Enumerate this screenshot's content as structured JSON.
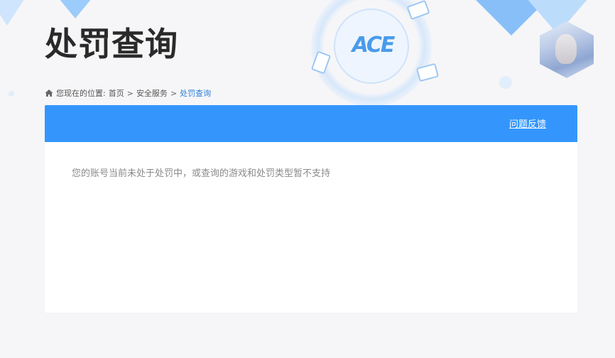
{
  "page": {
    "title": "处罚查询"
  },
  "header_art": {
    "logo_text": "ACE"
  },
  "breadcrumb": {
    "prefix": "您现在的位置:",
    "items": [
      "首页",
      "安全服务",
      "处罚查询"
    ],
    "separator": ">"
  },
  "panel": {
    "feedback_label": "问题反馈",
    "notice": "您的账号当前未处于处罚中，或查询的游戏和处罚类型暂不支持"
  },
  "colors": {
    "accent": "#3496fd",
    "breadcrumb_current": "#2f7fd4",
    "title": "#2a2a2a",
    "page_bg": "#f6f6f8"
  },
  "icons": {
    "breadcrumb_home": "home-icon"
  }
}
